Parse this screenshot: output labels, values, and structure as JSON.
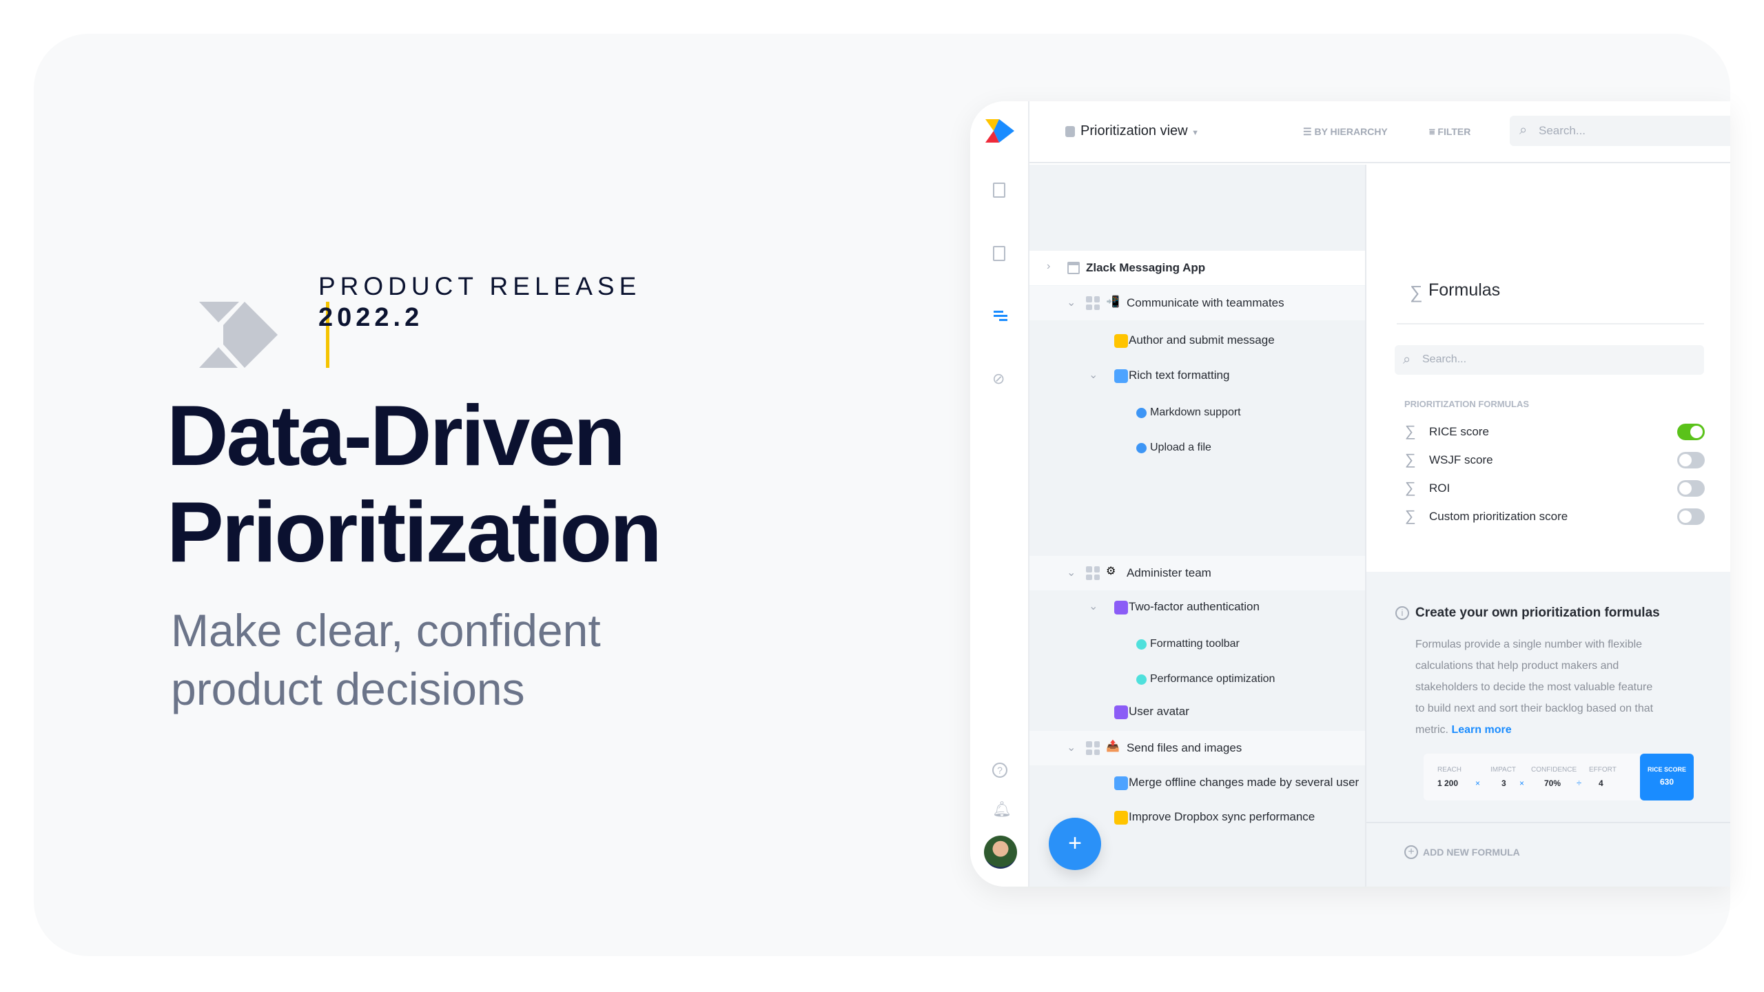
{
  "hero": {
    "eyebrow": "PRODUCT RELEASE",
    "version": "2022.2",
    "title_line1": "Data-Driven",
    "title_line2": "Prioritization",
    "subtitle_line1": "Make clear, confident",
    "subtitle_line2": "product decisions",
    "accent": "#f5c400"
  },
  "header": {
    "view_name": "Prioritization view",
    "group_by": "BY HIERARCHY",
    "filter": "FILTER",
    "search_placeholder": "Search..."
  },
  "tree": {
    "product": "Zlack Messaging App",
    "items": [
      {
        "label": "Communicate with teammates",
        "type": "component"
      },
      {
        "label": "Author and submit message",
        "type": "feature",
        "color": "#ffc400"
      },
      {
        "label": "Rich text formatting",
        "type": "feature",
        "color": "#4da3ff"
      },
      {
        "label": "Markdown support",
        "type": "subfeature",
        "color": "#3d95f5"
      },
      {
        "label": "Upload a file",
        "type": "subfeature",
        "color": "#3d95f5"
      },
      {
        "label": "Administer team",
        "type": "component"
      },
      {
        "label": "Two-factor authentication",
        "type": "feature",
        "color": "#8b5cf6"
      },
      {
        "label": "Formatting toolbar",
        "type": "subfeature",
        "color": "#4fe0dc"
      },
      {
        "label": "Performance optimization",
        "type": "subfeature",
        "color": "#4fe0dc"
      },
      {
        "label": "User avatar",
        "type": "feature",
        "color": "#8b5cf6"
      },
      {
        "label": "Send files and images",
        "type": "component"
      },
      {
        "label": "Merge offline changes made by several user",
        "type": "feature",
        "color": "#4da3ff"
      },
      {
        "label": "Improve Dropbox sync performance",
        "type": "feature",
        "color": "#ffc400"
      }
    ]
  },
  "formulas": {
    "title": "Formulas",
    "search_placeholder": "Search...",
    "section_label": "PRIORITIZATION FORMULAS",
    "items": [
      {
        "label": "RICE score",
        "enabled": true
      },
      {
        "label": "WSJF score",
        "enabled": false
      },
      {
        "label": "ROI",
        "enabled": false
      },
      {
        "label": "Custom prioritization score",
        "enabled": false
      }
    ],
    "info_title": "Create your own prioritization formulas",
    "info_lines": [
      "Formulas provide a single number with flexible",
      "calculations that help product makers and",
      "stakeholders to decide the most valuable feature",
      "to build next and sort their backlog based on that",
      "metric."
    ],
    "learn_more": "Learn more",
    "example": {
      "reach_label": "REACH",
      "reach": "1 200",
      "op1": "×",
      "impact_label": "IMPACT",
      "impact": "3",
      "op2": "×",
      "confidence_label": "CONFIDENCE",
      "confidence": "70%",
      "op3": "÷",
      "effort_label": "EFFORT",
      "effort": "4",
      "score_label": "RICE SCORE",
      "score": "630"
    },
    "add_new": "ADD NEW FORMULA",
    "toggle_on_color": "#5ac21a",
    "accent": "#1a8cff"
  }
}
